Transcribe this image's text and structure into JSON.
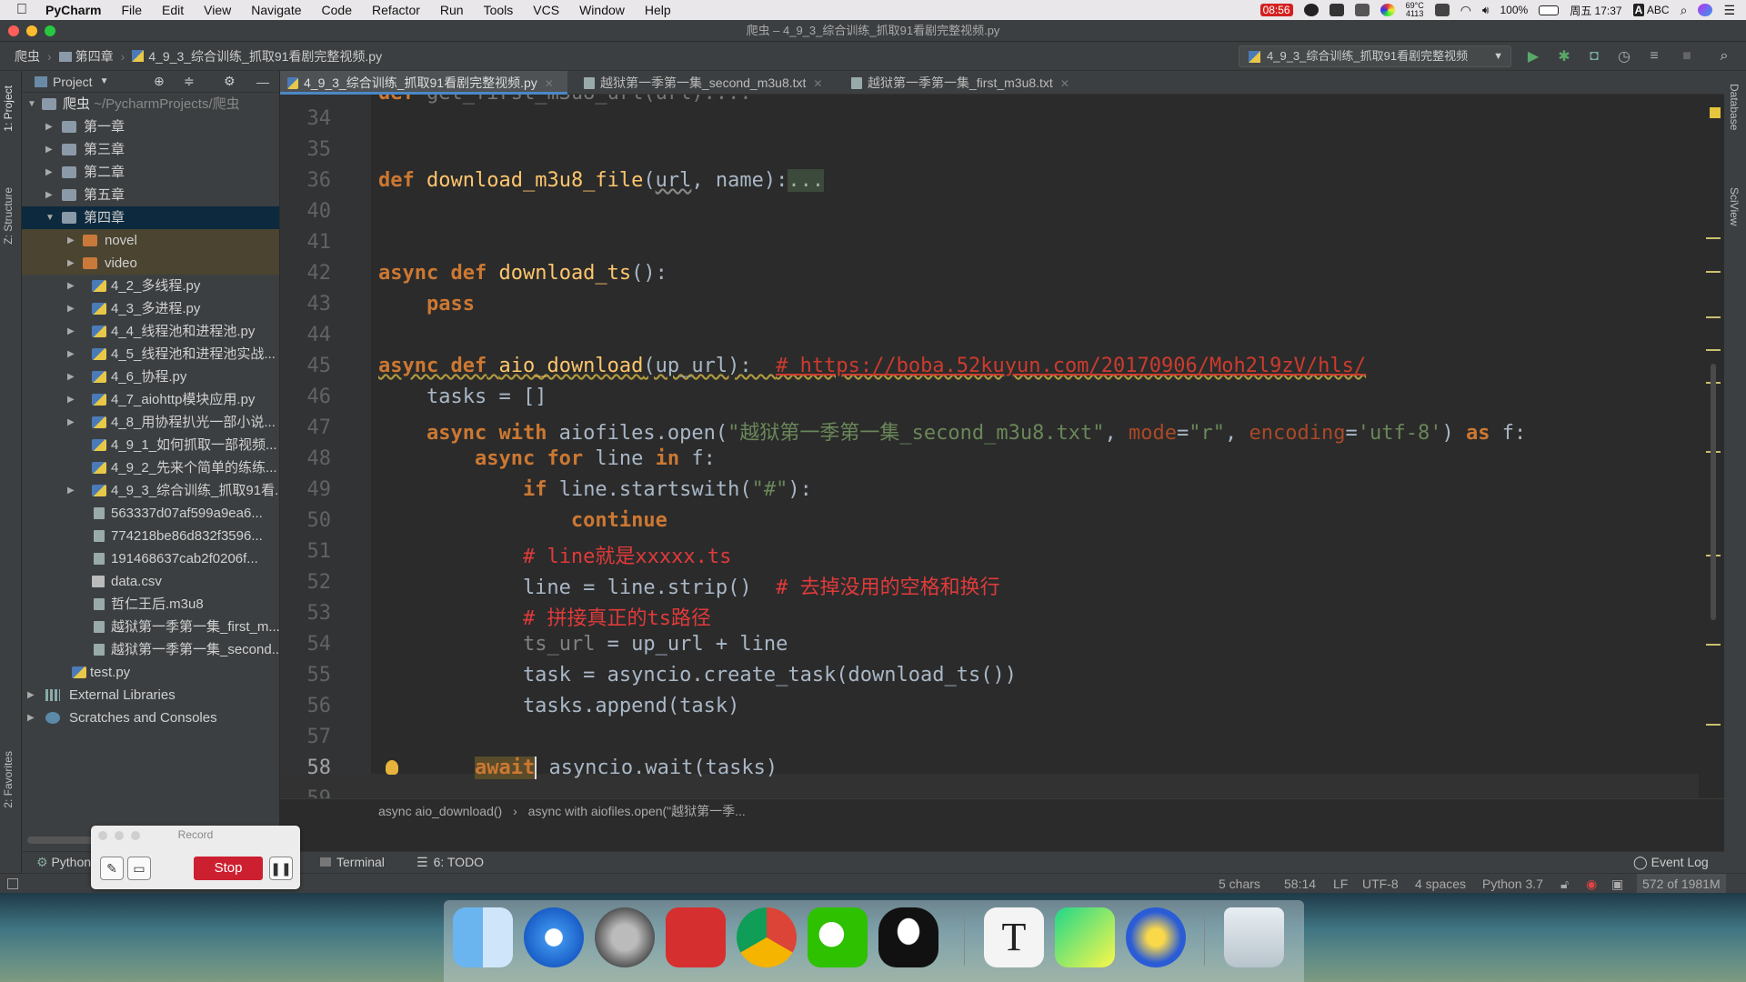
{
  "menubar": {
    "app": "PyCharm",
    "items": [
      "File",
      "Edit",
      "View",
      "Navigate",
      "Code",
      "Refactor",
      "Run",
      "Tools",
      "VCS",
      "Window",
      "Help"
    ],
    "time_red": "08:56",
    "temp": "69°C",
    "temp_sub": "4113",
    "battery": "100%",
    "clock": "周五 17:37",
    "input": "ABC"
  },
  "window_title": "爬虫 – 4_9_3_综合训练_抓取91看剧完整视频.py",
  "nav": {
    "crumbs": [
      "爬虫",
      "第四章",
      "4_9_3_综合训练_抓取91看剧完整视频.py"
    ],
    "run_config": "4_9_3_综合训练_抓取91看剧完整视频"
  },
  "left_tabs": {
    "project": "1: Project",
    "structure": "Z: Structure",
    "favorites": "2: Favorites"
  },
  "right_tabs": {
    "database": "Database",
    "sciview": "SciView"
  },
  "project": {
    "title": "Project",
    "root_name": "爬虫",
    "root_path": "~/PycharmProjects/爬虫",
    "tree": [
      {
        "label": "第一章"
      },
      {
        "label": "第三章"
      },
      {
        "label": "第二章"
      },
      {
        "label": "第五章"
      },
      {
        "label": "第四章"
      },
      {
        "label": "novel"
      },
      {
        "label": "video"
      },
      {
        "label": "4_2_多线程.py"
      },
      {
        "label": "4_3_多进程.py"
      },
      {
        "label": "4_4_线程池和进程池.py"
      },
      {
        "label": "4_5_线程池和进程池实战..."
      },
      {
        "label": "4_6_协程.py"
      },
      {
        "label": "4_7_aiohttp模块应用.py"
      },
      {
        "label": "4_8_用协程扒光一部小说..."
      },
      {
        "label": "4_9_1_如何抓取一部视频..."
      },
      {
        "label": "4_9_2_先来个简单的练练..."
      },
      {
        "label": "4_9_3_综合训练_抓取91看..."
      },
      {
        "label": "563337d07af599a9ea6..."
      },
      {
        "label": "774218be86d832f3596..."
      },
      {
        "label": "191468637cab2f0206f..."
      },
      {
        "label": "data.csv"
      },
      {
        "label": "哲仁王后.m3u8"
      },
      {
        "label": "越狱第一季第一集_first_m..."
      },
      {
        "label": "越狱第一季第一集_second..."
      },
      {
        "label": "test.py"
      },
      {
        "label": "External Libraries"
      },
      {
        "label": "Scratches and Consoles"
      }
    ]
  },
  "tabs": [
    {
      "label": "4_9_3_综合训练_抓取91看剧完整视频.py"
    },
    {
      "label": "越狱第一季第一集_second_m3u8.txt"
    },
    {
      "label": "越狱第一季第一集_first_m3u8.txt"
    }
  ],
  "code": {
    "line_numbers": [
      "34",
      "35",
      "36",
      "40",
      "41",
      "42",
      "43",
      "44",
      "45",
      "46",
      "47",
      "48",
      "49",
      "50",
      "51",
      "52",
      "53",
      "54",
      "55",
      "56",
      "57",
      "58",
      "59"
    ],
    "url_comment": "# https://boba.52kuyun.com/20170906/Moh2l9zV/hls/",
    "file_str": "\"越狱第一季第一集_second_m3u8.txt\"",
    "comment1": "# line就是xxxxx.ts",
    "comment2": "# 去掉没用的空格和换行",
    "comment3": "# 拼接真正的ts路径"
  },
  "breadcrumb": [
    "async aio_download()",
    "async with aiofiles.open(\"越狱第一季..."
  ],
  "bottom_tabs": {
    "python": "Python",
    "terminal": "Terminal",
    "todo": "6: TODO",
    "event_log": "Event Log"
  },
  "status": {
    "chars": "5 chars",
    "pos": "58:14",
    "eol": "LF",
    "enc": "UTF-8",
    "indent": "4 spaces",
    "interp": "Python 3.7",
    "memory": "572 of 1981M"
  },
  "record": {
    "title": "Record",
    "stop": "Stop"
  }
}
